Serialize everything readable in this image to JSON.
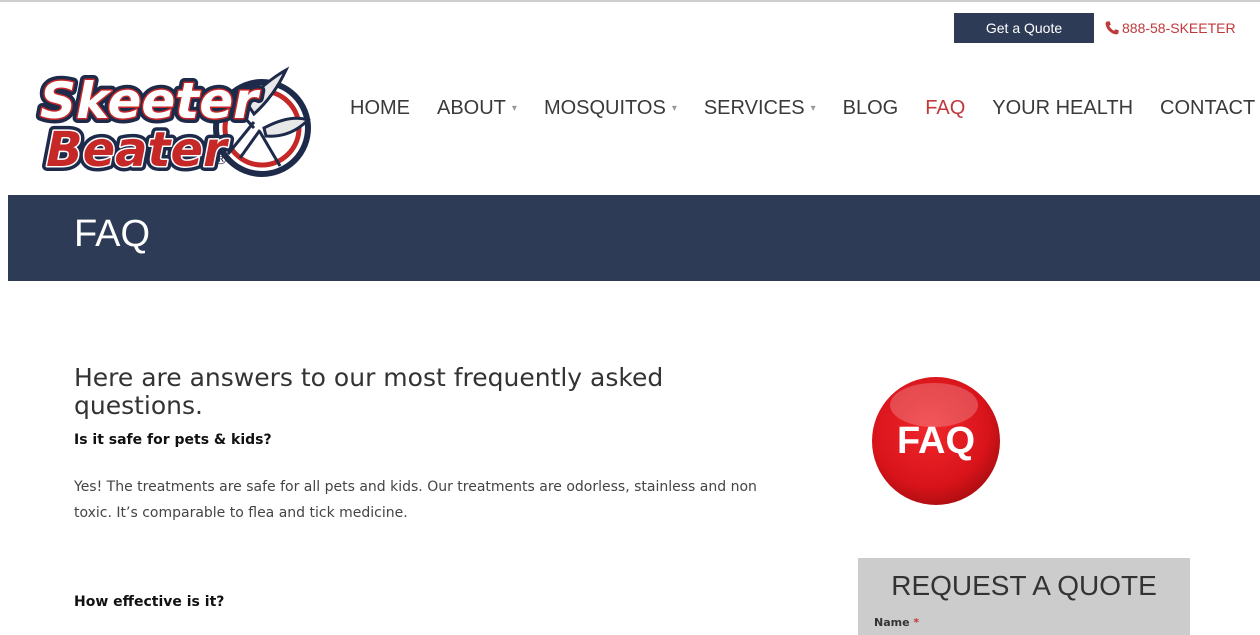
{
  "header": {
    "quote_button": "Get a Quote",
    "phone": "888-58-SKEETER"
  },
  "logo": {
    "line1": "Skeeter",
    "line2": "Beater",
    "registered": "®"
  },
  "nav": {
    "items": [
      {
        "label": "HOME"
      },
      {
        "label": "ABOUT",
        "caret": "▾"
      },
      {
        "label": "MOSQUITOS",
        "caret": "▾"
      },
      {
        "label": "SERVICES",
        "caret": "▾"
      },
      {
        "label": "BLOG"
      },
      {
        "label": "FAQ"
      },
      {
        "label": "YOUR HEALTH"
      },
      {
        "label": "CONTACT"
      }
    ],
    "active": "FAQ"
  },
  "banner": {
    "title": "FAQ"
  },
  "content": {
    "intro": "Here are answers to our most frequently asked questions.",
    "faqs": [
      {
        "question": "Is it safe for pets & kids?",
        "answer": "Yes! The treatments are safe for all pets and kids. Our treatments are odorless, stainless and non toxic. It’s comparable to flea and tick medicine."
      },
      {
        "question": "How effective is it?"
      }
    ]
  },
  "sidebar": {
    "badge_text": "FAQ",
    "quote_title": "REQUEST A QUOTE",
    "name_label": "Name",
    "required_mark": "*"
  },
  "colors": {
    "navy": "#2e3b57",
    "accent_red": "#c0393b",
    "badge_red": "#d8141a",
    "quote_box_bg": "#cccccc"
  }
}
